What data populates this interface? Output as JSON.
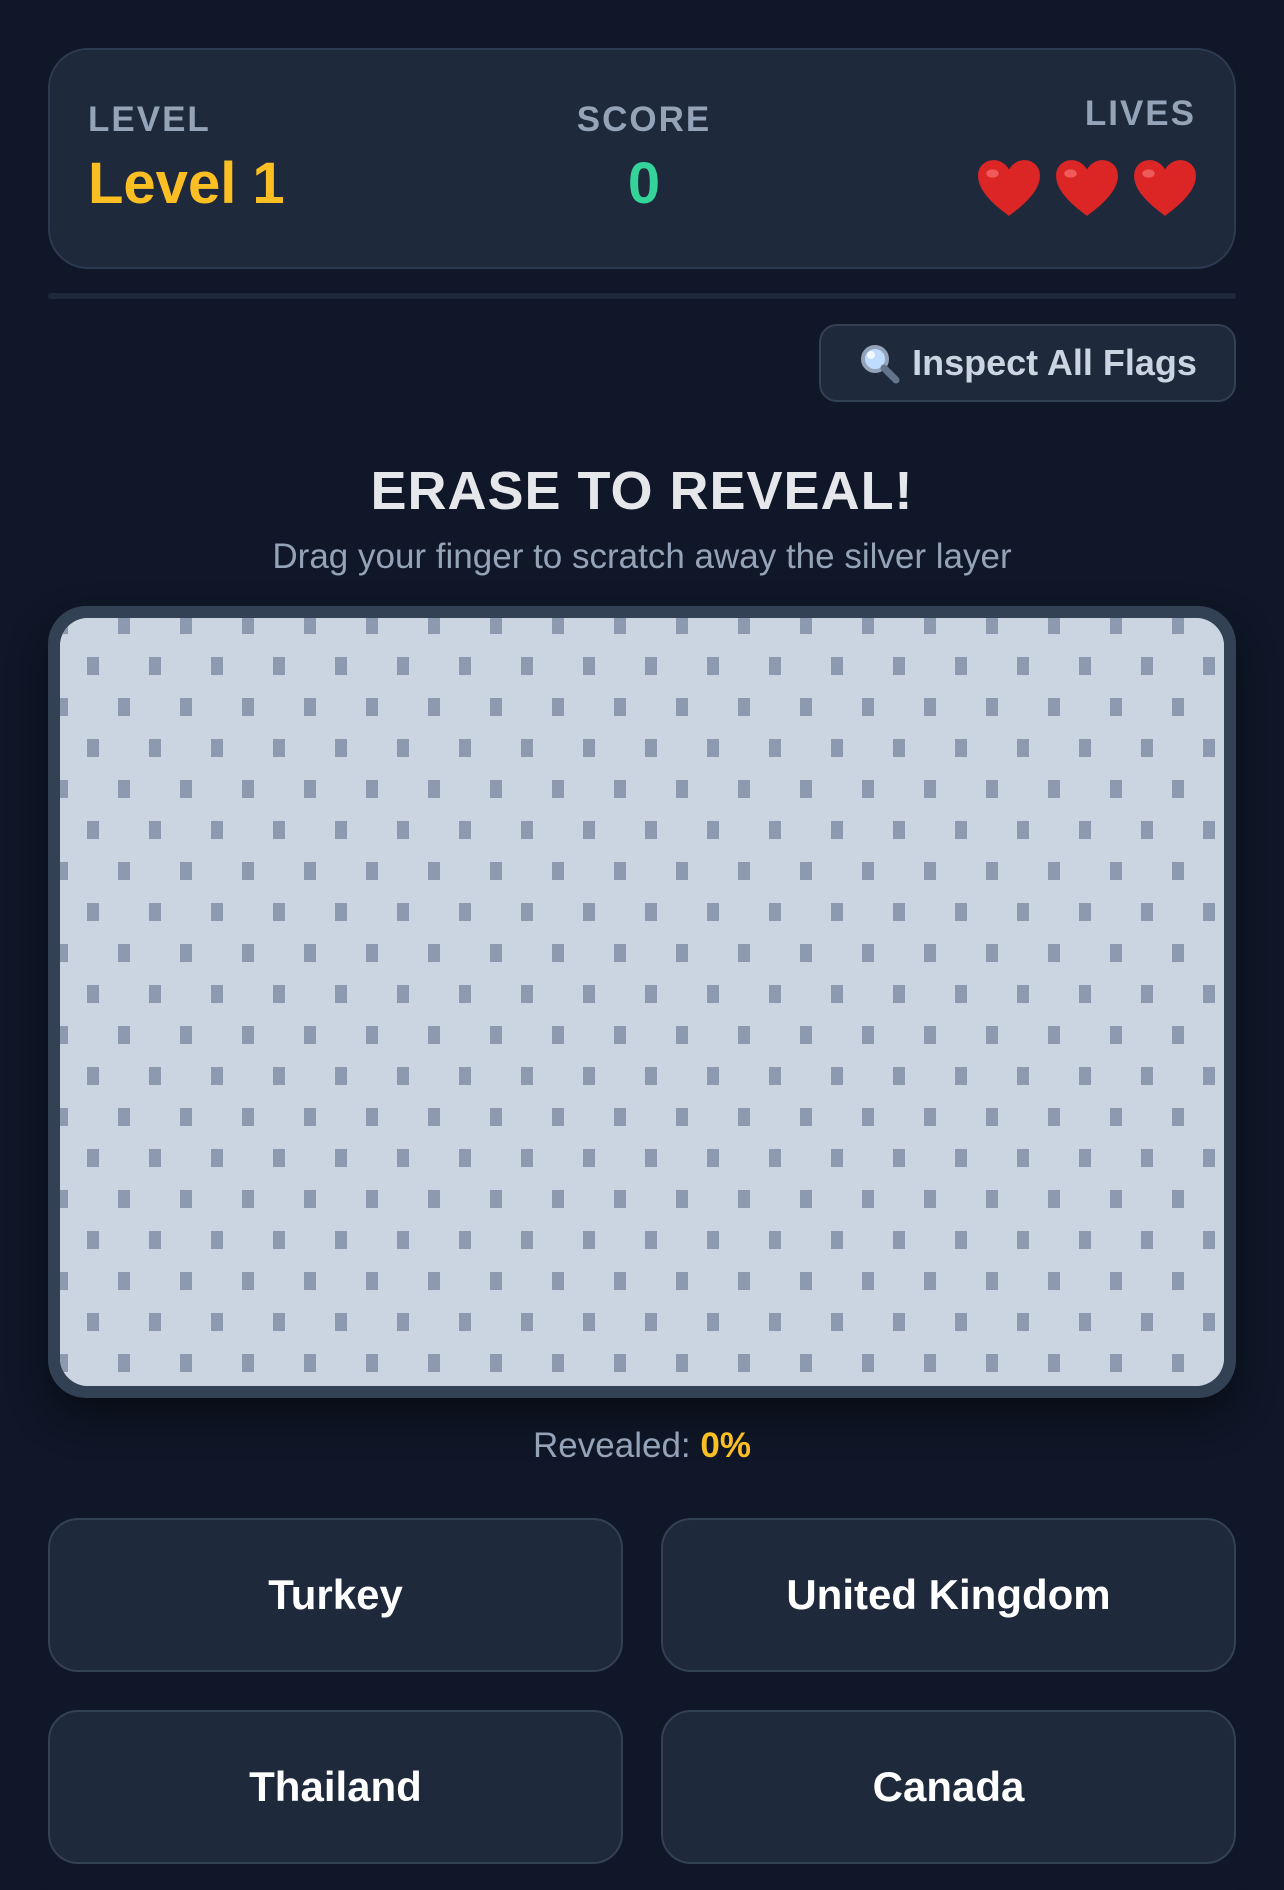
{
  "header": {
    "level_label": "LEVEL",
    "level_value": "Level 1",
    "score_label": "SCORE",
    "score_value": "0",
    "lives_label": "LIVES",
    "lives": 3
  },
  "inspect_button": {
    "icon": "magnifier-icon",
    "label": "Inspect All Flags"
  },
  "instructions": {
    "title": "ERASE TO REVEAL!",
    "subtitle": "Drag your finger to scratch away the silver layer"
  },
  "scratch_card": {
    "revealed_fraction": 0
  },
  "progress": {
    "prefix": "Revealed: ",
    "value": "0%"
  },
  "answers": [
    {
      "label": "Turkey"
    },
    {
      "label": "United Kingdom"
    },
    {
      "label": "Thailand"
    },
    {
      "label": "Canada"
    }
  ],
  "colors": {
    "background": "#0f1728",
    "panel": "#1e293b",
    "level_accent": "#fbbf24",
    "score_accent": "#34d399",
    "heart": "#dc2626",
    "silver_layer": "#cbd5e1"
  }
}
